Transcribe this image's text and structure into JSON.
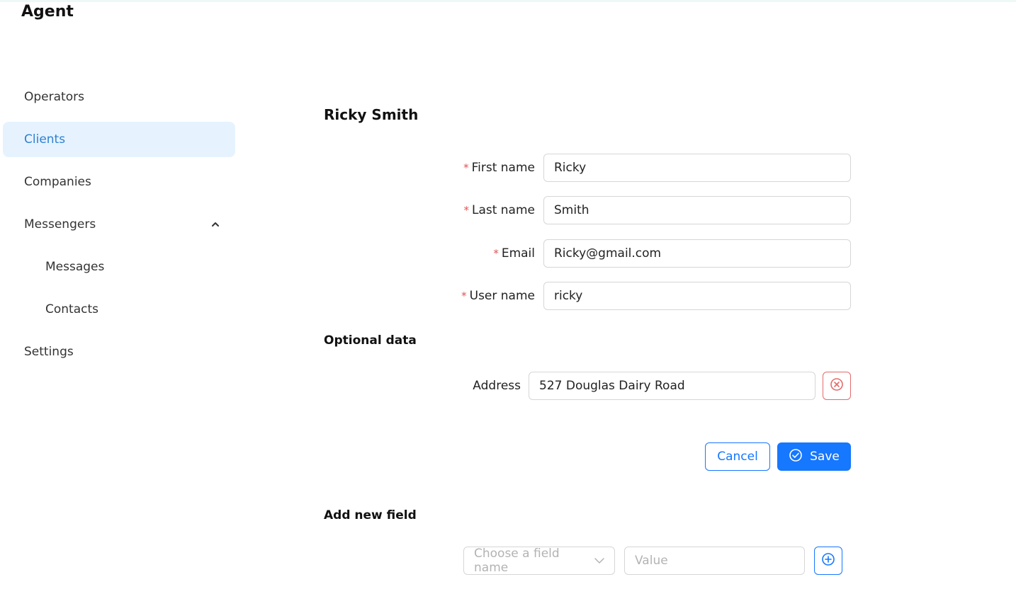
{
  "app": {
    "title": "Agent"
  },
  "sidebar": {
    "items": [
      {
        "label": "Operators",
        "active": false
      },
      {
        "label": "Clients",
        "active": true
      },
      {
        "label": "Companies",
        "active": false
      },
      {
        "label": "Messengers",
        "active": false,
        "expanded": true,
        "icon": "chevron-up-icon"
      },
      {
        "label": "Messages",
        "active": false,
        "sub": true
      },
      {
        "label": "Contacts",
        "active": false,
        "sub": true
      },
      {
        "label": "Settings",
        "active": false
      }
    ]
  },
  "client": {
    "title": "Ricky Smith",
    "fields": {
      "first_name": {
        "label": "First name",
        "value": "Ricky",
        "required": true
      },
      "last_name": {
        "label": "Last name",
        "value": "Smith",
        "required": true
      },
      "email": {
        "label": "Email",
        "value": "Ricky@gmail.com",
        "required": true
      },
      "user_name": {
        "label": "User name",
        "value": "ricky",
        "required": true
      }
    },
    "required_marker": "*"
  },
  "optional": {
    "title": "Optional data",
    "address": {
      "label": "Address",
      "value": "527 Douglas Dairy Road",
      "remove_icon": "close-circle-icon"
    }
  },
  "actions": {
    "cancel_label": "Cancel",
    "save_label": "Save",
    "save_icon": "check-circle-icon"
  },
  "new_field": {
    "title": "Add new field",
    "field_name_placeholder": "Choose a field name",
    "value_placeholder": "Value",
    "add_icon": "plus-circle-icon"
  },
  "colors": {
    "accent": "#1677ff",
    "active_bg": "#e6f3ff",
    "active_text": "#2f80d1",
    "danger": "#e36b6b",
    "required": "#e05555"
  }
}
